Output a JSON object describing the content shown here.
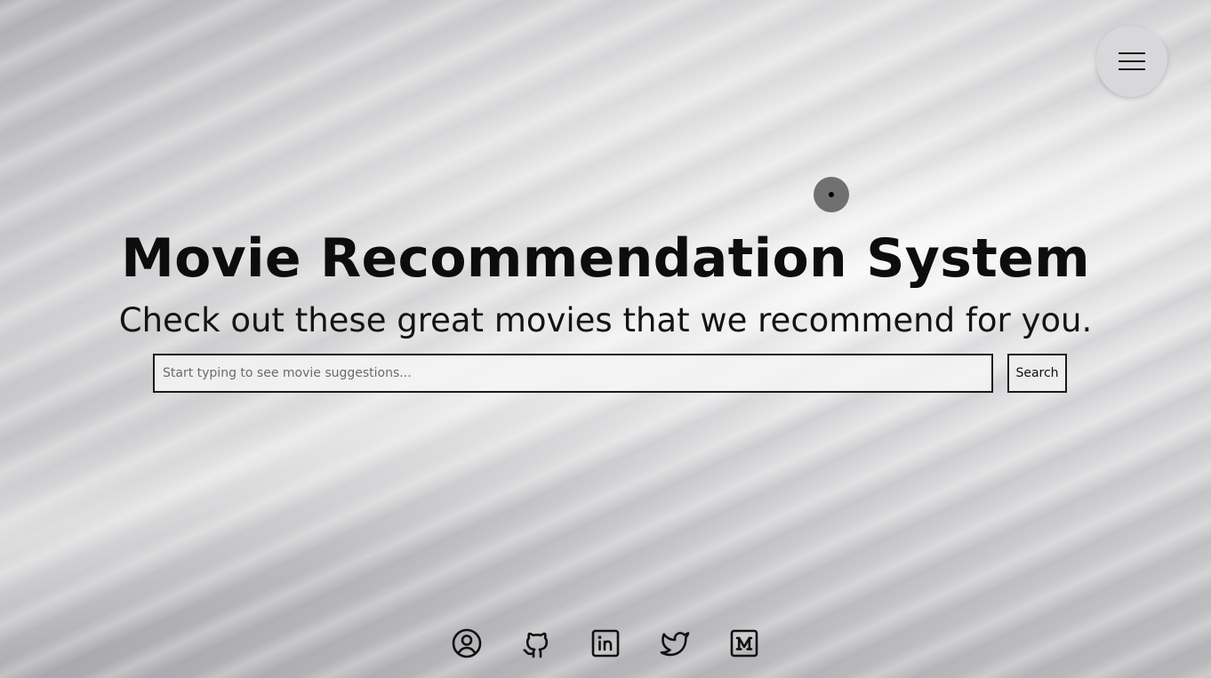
{
  "hero": {
    "title": "Movie Recommendation System",
    "subtitle": "Check out these great movies that we recommend for you."
  },
  "search": {
    "placeholder": "Start typing to see movie suggestions...",
    "value": "",
    "button_label": "Search"
  },
  "menu": {
    "icon": "hamburger-icon"
  },
  "social_links": [
    {
      "icon": "profile-icon"
    },
    {
      "icon": "github-icon"
    },
    {
      "icon": "linkedin-icon"
    },
    {
      "icon": "twitter-icon"
    },
    {
      "icon": "medium-icon"
    }
  ],
  "colors": {
    "text": "#0d0d0d",
    "border": "#1a1a1a",
    "menu_bg": "#d8d8da"
  }
}
